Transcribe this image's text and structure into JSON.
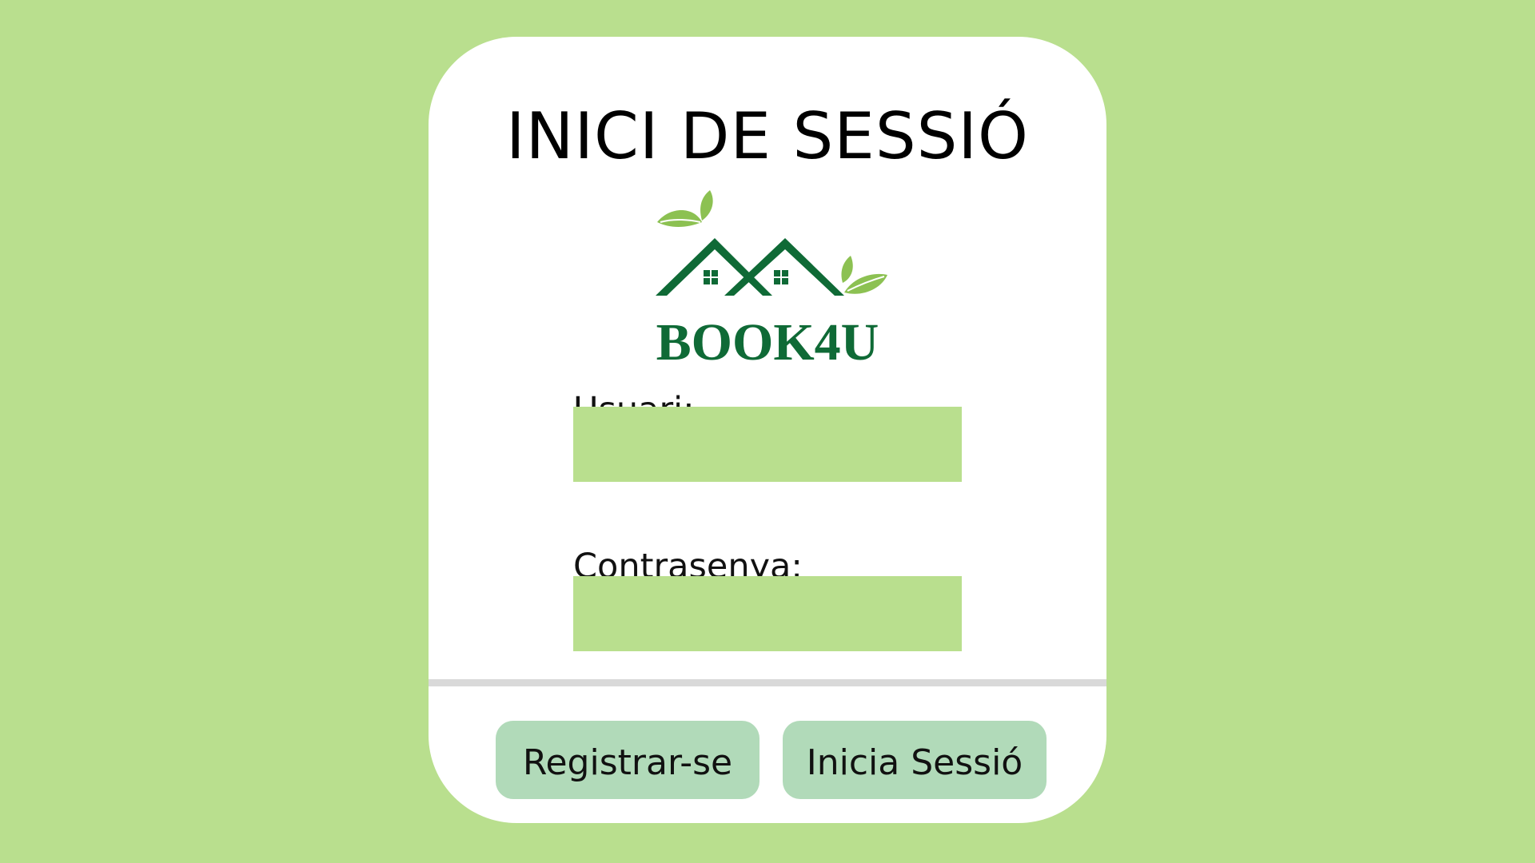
{
  "page": {
    "background_color": "#b9df8e",
    "card_color": "#ffffff"
  },
  "login": {
    "title": "INICI DE SESSIÓ",
    "logo": {
      "brand_text": "BOOK4U",
      "icon": "houses-leaves-logo",
      "brand_color": "#0f6a36",
      "leaf_color": "#8cc152"
    },
    "username": {
      "label": "Usuari:",
      "value": "",
      "placeholder": ""
    },
    "password": {
      "label": "Contrasenya:",
      "value": "",
      "placeholder": ""
    },
    "buttons": {
      "register_label": "Registrar-se",
      "login_label": "Inicia Sessió",
      "color": "#b1dab9"
    }
  }
}
